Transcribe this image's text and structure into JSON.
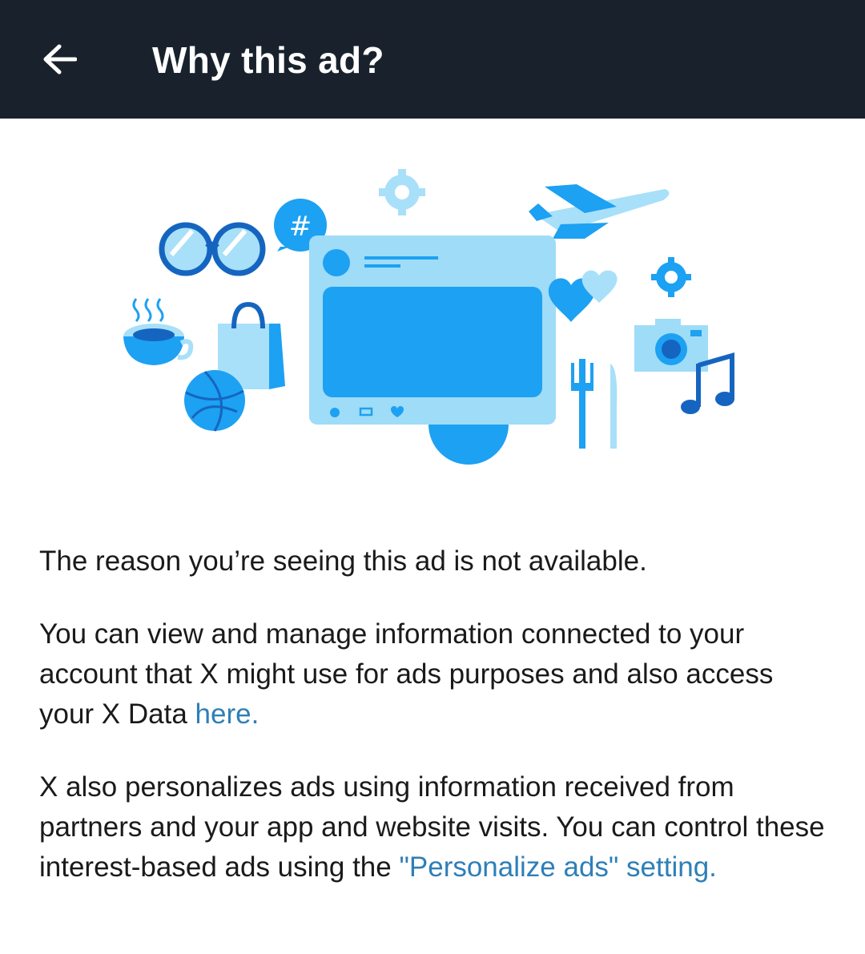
{
  "header": {
    "title": "Why this ad?",
    "back_icon": "arrow-left-icon"
  },
  "illustration": {
    "icons": [
      "sunglasses-icon",
      "hashtag-bubble-icon",
      "gear-icon",
      "airplane-icon",
      "coffee-cup-icon",
      "shopping-bag-icon",
      "basketball-icon",
      "tweet-card-icon",
      "hearts-icon",
      "camera-icon",
      "music-note-icon",
      "fork-knife-icon"
    ],
    "colors": {
      "light": "#a8e0f9",
      "mid": "#1da1f2",
      "dark": "#1565c0",
      "card": "#9fdcf8"
    }
  },
  "body": {
    "reason": "The reason you’re seeing this ad is not available.",
    "manage_text": "You can view and manage information connected to your account that X might use for ads purposes and also access your X Data ",
    "manage_link": "here.",
    "personalize_text": "X also personalizes ads using information received from partners and your app and website visits. You can control these interest-based ads using the ",
    "personalize_link": "\"Personalize ads\" setting."
  },
  "colors": {
    "appbar_bg": "#19222c",
    "link": "#2e7fb8",
    "text": "#1a1a1a"
  }
}
